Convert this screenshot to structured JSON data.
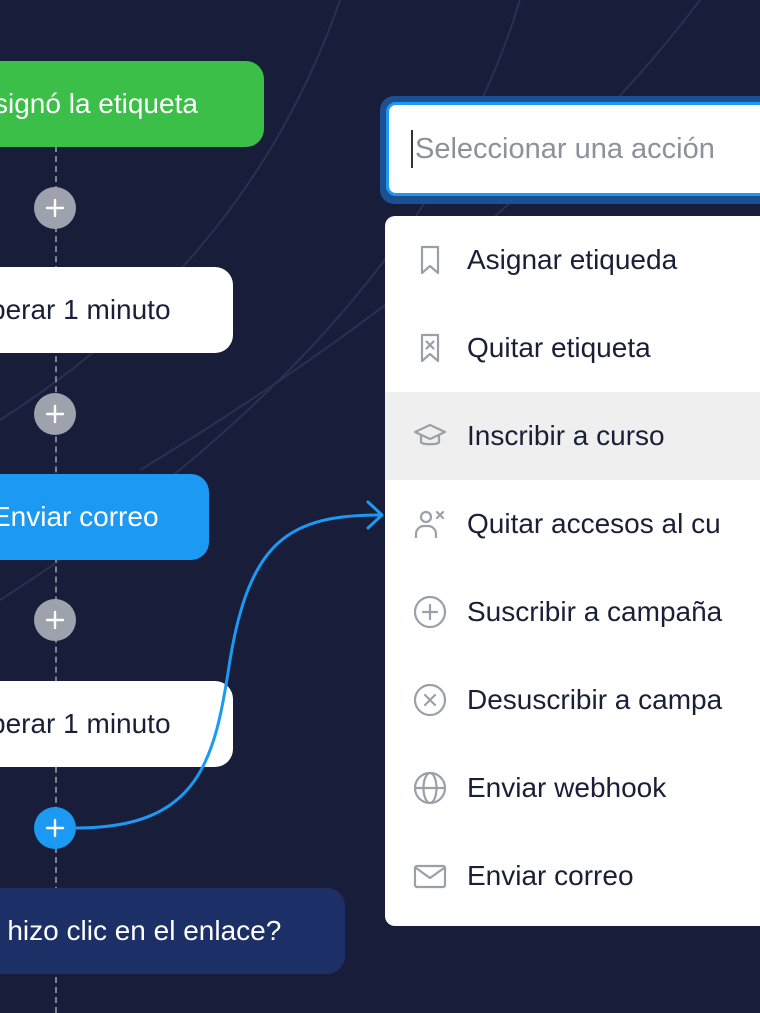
{
  "flow": {
    "nodes": [
      {
        "id": "tag",
        "label": "signó la etiqueta"
      },
      {
        "id": "wait1",
        "label": "perar 1 minuto"
      },
      {
        "id": "email",
        "label": "Enviar correo"
      },
      {
        "id": "wait2",
        "label": "perar 1 minuto"
      },
      {
        "id": "condition",
        "label": "o hizo clic en el enlace?"
      }
    ]
  },
  "action_select": {
    "placeholder": "Seleccionar una acción",
    "items": [
      {
        "label": "Asignar etiqueda",
        "icon": "bookmark-icon"
      },
      {
        "label": "Quitar etiqueta",
        "icon": "bookmark-remove-icon"
      },
      {
        "label": "Inscribir a curso",
        "icon": "graduation-cap-icon",
        "highlighted": true
      },
      {
        "label": "Quitar accesos al cu",
        "icon": "user-remove-icon"
      },
      {
        "label": "Suscribir a campaña",
        "icon": "plus-circle-icon"
      },
      {
        "label": "Desuscribir a campa",
        "icon": "x-circle-icon"
      },
      {
        "label": "Enviar webhook",
        "icon": "globe-icon"
      },
      {
        "label": "Enviar correo",
        "icon": "mail-icon"
      }
    ]
  },
  "colors": {
    "background": "#181d3a",
    "green": "#3bbf49",
    "blue": "#1c9af3",
    "navy": "#1c2f66",
    "highlight": "#efefef"
  }
}
